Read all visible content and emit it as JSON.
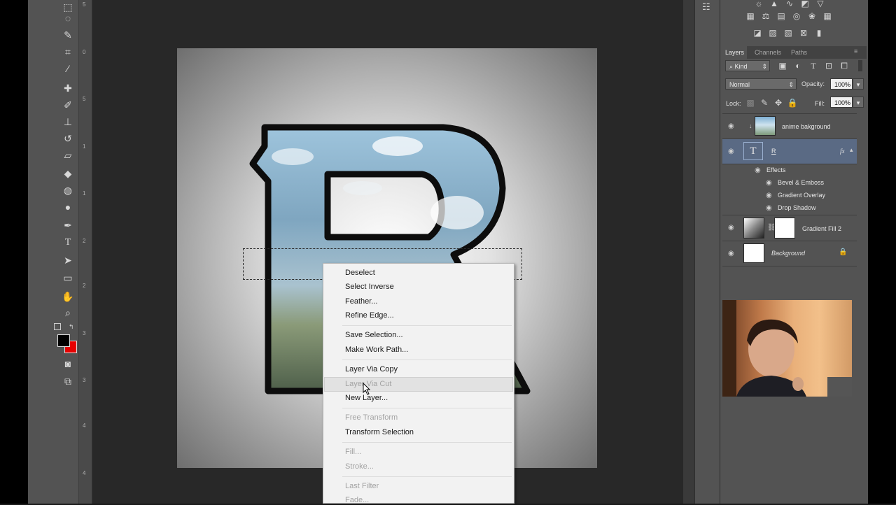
{
  "context_menu": {
    "items": [
      {
        "label": "Deselect",
        "enabled": true
      },
      {
        "label": "Select Inverse",
        "enabled": true
      },
      {
        "label": "Feather...",
        "enabled": true
      },
      {
        "label": "Refine Edge...",
        "enabled": true
      },
      {
        "label": "Save Selection...",
        "enabled": true
      },
      {
        "label": "Make Work Path...",
        "enabled": true
      },
      {
        "label": "Layer Via Copy",
        "enabled": true
      },
      {
        "label": "Layer Via Cut",
        "enabled": false,
        "hovered": true
      },
      {
        "label": "New Layer...",
        "enabled": true
      },
      {
        "label": "Free Transform",
        "enabled": false
      },
      {
        "label": "Transform Selection",
        "enabled": true
      },
      {
        "label": "Fill...",
        "enabled": false
      },
      {
        "label": "Stroke...",
        "enabled": false
      },
      {
        "label": "Last Filter",
        "enabled": false
      },
      {
        "label": "Fade...",
        "enabled": false
      }
    ]
  },
  "layers_panel": {
    "tabs": [
      "Layers",
      "Channels",
      "Paths"
    ],
    "active_tab": "Layers",
    "filter_kind": "Kind",
    "blend_mode": "Normal",
    "opacity_label": "Opacity:",
    "opacity_value": "100%",
    "lock_label": "Lock:",
    "fill_label": "Fill:",
    "fill_value": "100%",
    "layers": [
      {
        "name": "anime bakground",
        "type": "image",
        "clipped": true
      },
      {
        "name": "R",
        "type": "text",
        "selected": true,
        "fx": "fx"
      },
      {
        "name": "Gradient Fill 2",
        "type": "fill"
      },
      {
        "name": "Background",
        "type": "background",
        "locked": true
      }
    ],
    "effects_label": "Effects",
    "effects": [
      "Bevel & Emboss",
      "Gradient Overlay",
      "Drop Shadow"
    ]
  },
  "ruler": {
    "labels": [
      "5",
      "0",
      "5",
      "1",
      "1",
      "2",
      "2",
      "3",
      "3",
      "4",
      "4"
    ]
  },
  "colors": {
    "foreground": "#000000",
    "background": "#e60000",
    "selected_layer": "#5a6a84"
  }
}
